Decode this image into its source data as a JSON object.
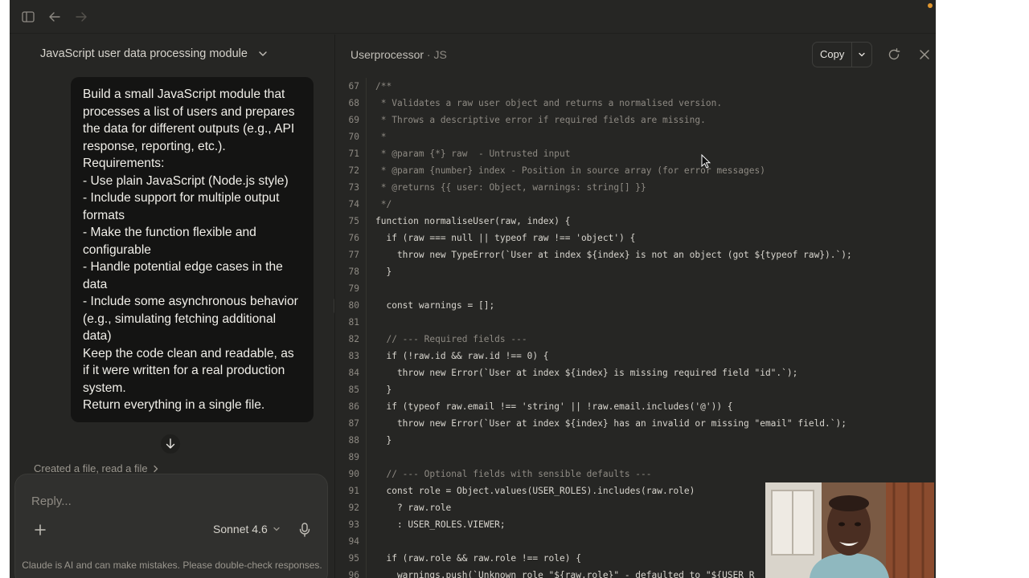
{
  "window": {
    "accent_dot_color": "#e0962f"
  },
  "toolbar": {
    "sidebar_icon": "sidebar-toggle-icon",
    "back_icon": "arrow-left-icon",
    "forward_icon": "arrow-right-icon"
  },
  "chat": {
    "title": "JavaScript user data processing module",
    "user_message": "Build a small JavaScript module that processes a list of users and prepares the data for different outputs (e.g., API response, reporting, etc.).\nRequirements:\n- Use plain JavaScript (Node.js style)\n- Include support for multiple output formats\n- Make the function flexible and configurable\n- Handle potential edge cases in the data\n- Include some asynchronous behavior (e.g., simulating fetching additional data)\nKeep the code clean and readable, as if it were written for a real production system.\nReturn everything in a single file.",
    "activity": "Created a file, read a file",
    "composer": {
      "placeholder": "Reply...",
      "model": "Sonnet 4.6"
    },
    "disclaimer": "Claude is AI and can make mistakes. Please double-check responses."
  },
  "artifact": {
    "title": "Userprocessor",
    "type": "JS",
    "copy_label": "Copy",
    "lines": [
      {
        "n": "67",
        "code": "/**"
      },
      {
        "n": "68",
        "code": " * Validates a raw user object and returns a normalised version."
      },
      {
        "n": "69",
        "code": " * Throws a descriptive error if required fields are missing."
      },
      {
        "n": "70",
        "code": " *"
      },
      {
        "n": "71",
        "code": " * @param {*} raw  - Untrusted input"
      },
      {
        "n": "72",
        "code": " * @param {number} index - Position in source array (for error messages)"
      },
      {
        "n": "73",
        "code": " * @returns {{ user: Object, warnings: string[] }}"
      },
      {
        "n": "74",
        "code": " */"
      },
      {
        "n": "75",
        "code": "function normaliseUser(raw, index) {"
      },
      {
        "n": "76",
        "code": "  if (raw === null || typeof raw !== 'object') {"
      },
      {
        "n": "77",
        "code": "    throw new TypeError(`User at index ${index} is not an object (got ${typeof raw}).`);"
      },
      {
        "n": "78",
        "code": "  }"
      },
      {
        "n": "79",
        "code": ""
      },
      {
        "n": "80",
        "code": "  const warnings = [];"
      },
      {
        "n": "81",
        "code": ""
      },
      {
        "n": "82",
        "code": "  // --- Required fields ---"
      },
      {
        "n": "83",
        "code": "  if (!raw.id && raw.id !== 0) {"
      },
      {
        "n": "84",
        "code": "    throw new Error(`User at index ${index} is missing required field \"id\".`);"
      },
      {
        "n": "85",
        "code": "  }"
      },
      {
        "n": "86",
        "code": "  if (typeof raw.email !== 'string' || !raw.email.includes('@')) {"
      },
      {
        "n": "87",
        "code": "    throw new Error(`User at index ${index} has an invalid or missing \"email\" field.`);"
      },
      {
        "n": "88",
        "code": "  }"
      },
      {
        "n": "89",
        "code": ""
      },
      {
        "n": "90",
        "code": "  // --- Optional fields with sensible defaults ---"
      },
      {
        "n": "91",
        "code": "  const role = Object.values(USER_ROLES).includes(raw.role)"
      },
      {
        "n": "92",
        "code": "    ? raw.role"
      },
      {
        "n": "93",
        "code": "    : USER_ROLES.VIEWER;"
      },
      {
        "n": "94",
        "code": ""
      },
      {
        "n": "95",
        "code": "  if (raw.role && raw.role !== role) {"
      },
      {
        "n": "96",
        "code": "    warnings.push(`Unknown role \"${raw.role}\" - defaulted to \"${USER_R"
      }
    ]
  }
}
